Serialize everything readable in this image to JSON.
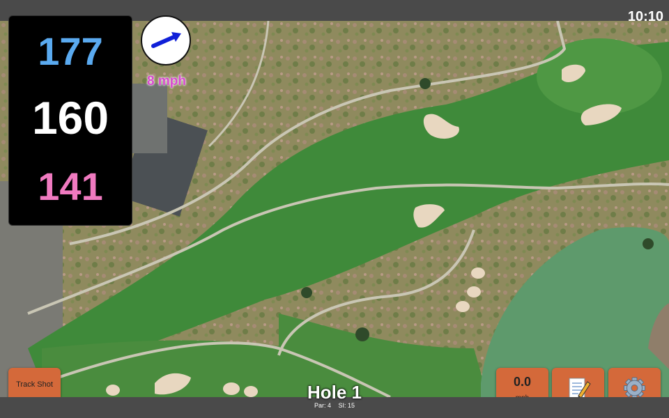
{
  "status_bar": {
    "time": "10:10"
  },
  "distances": {
    "back": "177",
    "middle": "160",
    "front": "141"
  },
  "wind": {
    "speed": "8 mph",
    "direction_icon": "arrow-icon"
  },
  "buttons": {
    "track_shot_label": "Track Shot",
    "speed_value": "0.0",
    "speed_unit": "mph",
    "notes_icon": "notepad-icon",
    "settings_icon": "gear-icon"
  },
  "hole": {
    "title": "Hole 1",
    "par": "Par: 4",
    "si": "SI: 15"
  },
  "colors": {
    "back_distance": "#5aaaf0",
    "middle_distance": "#ffffff",
    "front_distance": "#f07ac0",
    "wind_text": "#d84ad0",
    "button": "#d4693a",
    "fairway": "#3f8a3a",
    "water": "#5e9a6c"
  }
}
